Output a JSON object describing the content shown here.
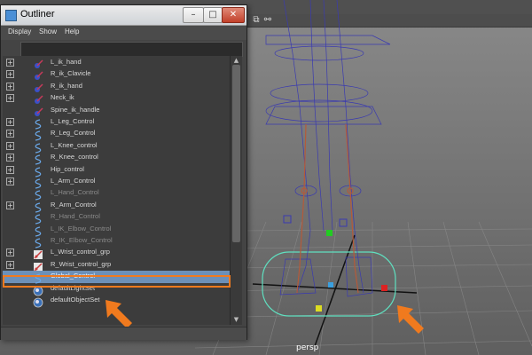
{
  "window": {
    "title": "Outliner",
    "minimize": "–",
    "maximize": "□",
    "close": "✕"
  },
  "menu": [
    "Display",
    "Show",
    "Help"
  ],
  "search": {
    "value": ""
  },
  "items": [
    {
      "label": "L_ik_hand",
      "icon": "ik-handle-icon",
      "expand": "+",
      "dim": false
    },
    {
      "label": "R_ik_Clavicle",
      "icon": "ik-handle-icon",
      "expand": "+",
      "dim": false
    },
    {
      "label": "R_ik_hand",
      "icon": "ik-handle-icon",
      "expand": "+",
      "dim": false
    },
    {
      "label": "Neck_ik",
      "icon": "ik-handle-icon",
      "expand": "+",
      "dim": false
    },
    {
      "label": "Spine_ik_handle",
      "icon": "ik-handle-icon",
      "expand": "",
      "dim": false
    },
    {
      "label": "L_Leg_Control",
      "icon": "curve-icon",
      "expand": "+",
      "dim": false
    },
    {
      "label": "R_Leg_Control",
      "icon": "curve-icon",
      "expand": "+",
      "dim": false
    },
    {
      "label": "L_Knee_control",
      "icon": "curve-icon",
      "expand": "+",
      "dim": false
    },
    {
      "label": "R_Knee_control",
      "icon": "curve-icon",
      "expand": "+",
      "dim": false
    },
    {
      "label": "Hip_control",
      "icon": "curve-icon",
      "expand": "+",
      "dim": false
    },
    {
      "label": "L_Arm_Control",
      "icon": "curve-icon",
      "expand": "+",
      "dim": false
    },
    {
      "label": "L_Hand_Control",
      "icon": "curve-icon",
      "expand": "",
      "dim": true
    },
    {
      "label": "R_Arm_Control",
      "icon": "curve-icon",
      "expand": "+",
      "dim": false
    },
    {
      "label": "R_Hand_Control",
      "icon": "curve-icon",
      "expand": "",
      "dim": true
    },
    {
      "label": "L_IK_Elbow_Control",
      "icon": "curve-icon",
      "expand": "",
      "dim": true
    },
    {
      "label": "R_IK_Elbow_Control",
      "icon": "curve-icon",
      "expand": "",
      "dim": true
    },
    {
      "label": "L_Wrist_control_grp",
      "icon": "group-icon",
      "expand": "+",
      "dim": false
    },
    {
      "label": "R_Wrist_control_grp",
      "icon": "group-icon",
      "expand": "+",
      "dim": false
    },
    {
      "label": "Global_Control",
      "icon": "curve-icon",
      "expand": "",
      "dim": false,
      "selected": true
    },
    {
      "label": "defaultLightSet",
      "icon": "set-icon",
      "expand": "",
      "dim": false
    },
    {
      "label": "defaultObjectSet",
      "icon": "set-icon",
      "expand": "",
      "dim": false
    }
  ],
  "viewport": {
    "camera_label": "persp",
    "tool_icons": [
      "frame-icon",
      "share-icon"
    ]
  },
  "colors": {
    "selection": "#6c90b8",
    "highlight": "#f07a1e",
    "rig": "#2a2aa8",
    "skeleton": "#b45a3a"
  }
}
